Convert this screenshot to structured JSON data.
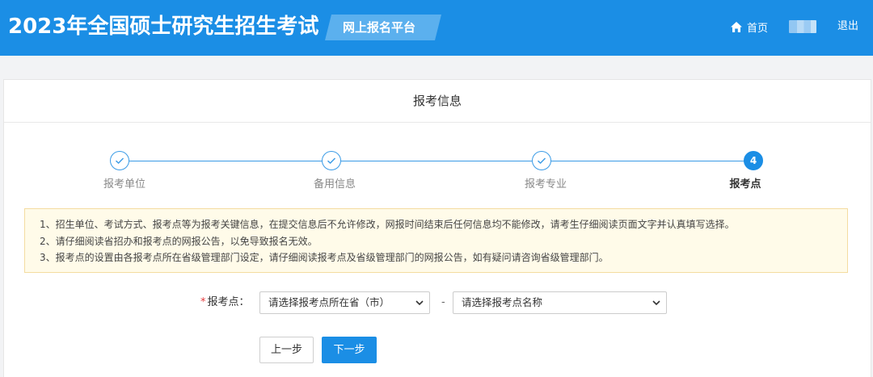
{
  "header": {
    "site_title": "2023年全国硕士研究生招生考试",
    "platform_label": "网上报名平台",
    "home_label": "首页",
    "logout_label": "退出",
    "brand_color": "#1b8ee5"
  },
  "card": {
    "title": "报考信息"
  },
  "steps": [
    {
      "label": "报考单位",
      "state": "done",
      "icon": "check-icon"
    },
    {
      "label": "备用信息",
      "state": "done",
      "icon": "check-icon"
    },
    {
      "label": "报考专业",
      "state": "done",
      "icon": "check-icon"
    },
    {
      "label": "报考点",
      "state": "active",
      "number": "4"
    }
  ],
  "notice": {
    "lines": [
      "1、招生单位、考试方式、报考点等为报考关键信息，在提交信息后不允许修改，网报时间结束后任何信息均不能修改，请考生仔细阅读页面文字并认真填写选择。",
      "2、请仔细阅读省招办和报考点的网报公告，以免导致报名无效。",
      "3、报考点的设置由各报考点所在省级管理部门设定，请仔细阅读报考点及省级管理部门的网报公告，如有疑问请咨询省级管理部门。"
    ]
  },
  "form": {
    "required_mark": "*",
    "label": "报考点：",
    "province_select": "请选择报考点所在省（市）",
    "separator": "-",
    "site_select": "请选择报考点名称"
  },
  "buttons": {
    "prev_label": "上一步",
    "next_label": "下一步"
  }
}
